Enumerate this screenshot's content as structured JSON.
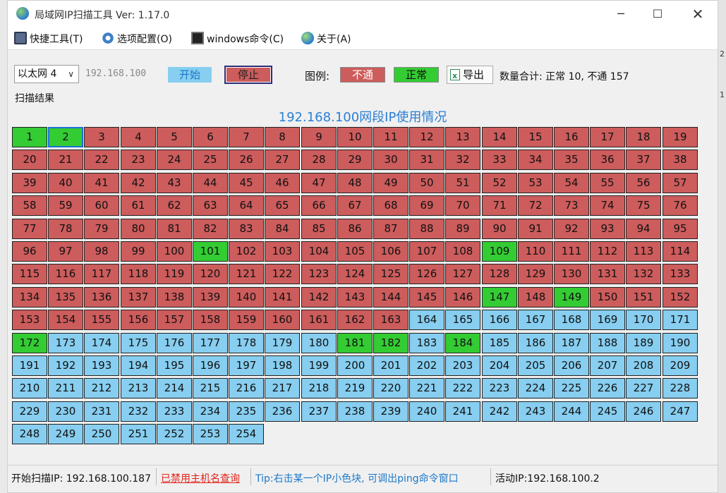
{
  "window": {
    "title": "局域网IP扫描工具  Ver: 1.17.0",
    "minimize_glyph": "─",
    "maximize_glyph": "☐",
    "close_glyph": "✕"
  },
  "menu": [
    {
      "label": "快捷工具(T)",
      "icon": "tools-icon"
    },
    {
      "label": "选项配置(O)",
      "icon": "gear-icon"
    },
    {
      "label": "windows命令(C)",
      "icon": "terminal-icon"
    },
    {
      "label": "关于(A)",
      "icon": "globe-icon"
    }
  ],
  "toolbar": {
    "adapter_selected": "以太网 4",
    "ip_prefix": "192.168.100",
    "start_label": "开始",
    "stop_label": "停止",
    "legend_label": "图例:",
    "legend_bad": "不通",
    "legend_ok": "正常",
    "export_label": "导出",
    "count_text": "数量合计: 正常 10, 不通 157"
  },
  "results": {
    "label": "扫描结果",
    "title": "192.168.100网段IP使用情况"
  },
  "colors": {
    "bad": "#cd5c5c",
    "ok": "#33cc33",
    "unscanned": "#87cef0",
    "title_blue": "#2a7fd4"
  },
  "grid": {
    "columns": 19,
    "first": 1,
    "last": 254,
    "ok_ips": [
      1,
      2,
      101,
      109,
      147,
      149,
      172,
      181,
      182,
      184
    ],
    "scanned_through": 163,
    "selected_ip": 2
  },
  "status": {
    "start_ip": "开始扫描IP: 192.168.100.187",
    "hostname": "已禁用主机名查询",
    "tip": "Tip:右击某一个IP小色块, 可调出ping命令窗口",
    "active": "活动IP:192.168.100.2"
  },
  "backdrop": {
    "char_top": "2",
    "char_mid": "1"
  }
}
